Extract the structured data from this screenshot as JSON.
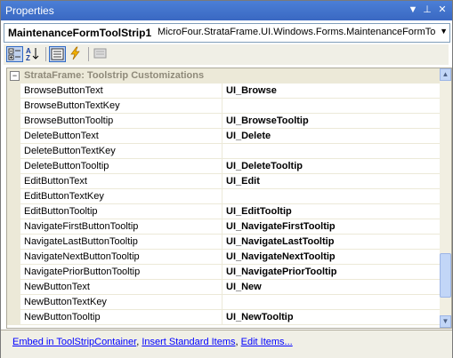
{
  "window": {
    "title": "Properties",
    "buttons": [
      "▼",
      "⊥",
      "✕"
    ]
  },
  "object_selector": {
    "name": "MaintenanceFormToolStrip1",
    "type": "MicroFour.StrataFrame.UI.Windows.Forms.MaintenanceFormToo"
  },
  "category": {
    "toggle": "−",
    "label": "StrataFrame: Toolstrip Customizations"
  },
  "properties": [
    {
      "name": "BrowseButtonText",
      "value": "UI_Browse"
    },
    {
      "name": "BrowseButtonTextKey",
      "value": ""
    },
    {
      "name": "BrowseButtonTooltip",
      "value": "UI_BrowseTooltip"
    },
    {
      "name": "DeleteButtonText",
      "value": "UI_Delete"
    },
    {
      "name": "DeleteButtonTextKey",
      "value": ""
    },
    {
      "name": "DeleteButtonTooltip",
      "value": "UI_DeleteTooltip"
    },
    {
      "name": "EditButtonText",
      "value": "UI_Edit"
    },
    {
      "name": "EditButtonTextKey",
      "value": ""
    },
    {
      "name": "EditButtonTooltip",
      "value": "UI_EditTooltip"
    },
    {
      "name": "NavigateFirstButtonTooltip",
      "value": "UI_NavigateFirstTooltip"
    },
    {
      "name": "NavigateLastButtonTooltip",
      "value": "UI_NavigateLastTooltip"
    },
    {
      "name": "NavigateNextButtonTooltip",
      "value": "UI_NavigateNextTooltip"
    },
    {
      "name": "NavigatePriorButtonTooltip",
      "value": "UI_NavigatePriorTooltip"
    },
    {
      "name": "NewButtonText",
      "value": "UI_New"
    },
    {
      "name": "NewButtonTextKey",
      "value": ""
    },
    {
      "name": "NewButtonTooltip",
      "value": "UI_NewTooltip"
    }
  ],
  "verbs": {
    "embed": "Embed in ToolStripContainer",
    "insert": "Insert Standard Items",
    "edit": "Edit Items...",
    "sep": ", "
  },
  "toolbar": {
    "icons": [
      "categorized-icon",
      "alphabetical-icon",
      "properties-icon",
      "events-icon",
      "property-pages-icon"
    ]
  },
  "colors": {
    "titlebar": "#3a68c2",
    "link": "#0000ff",
    "category_bg": "#ece9d8"
  }
}
